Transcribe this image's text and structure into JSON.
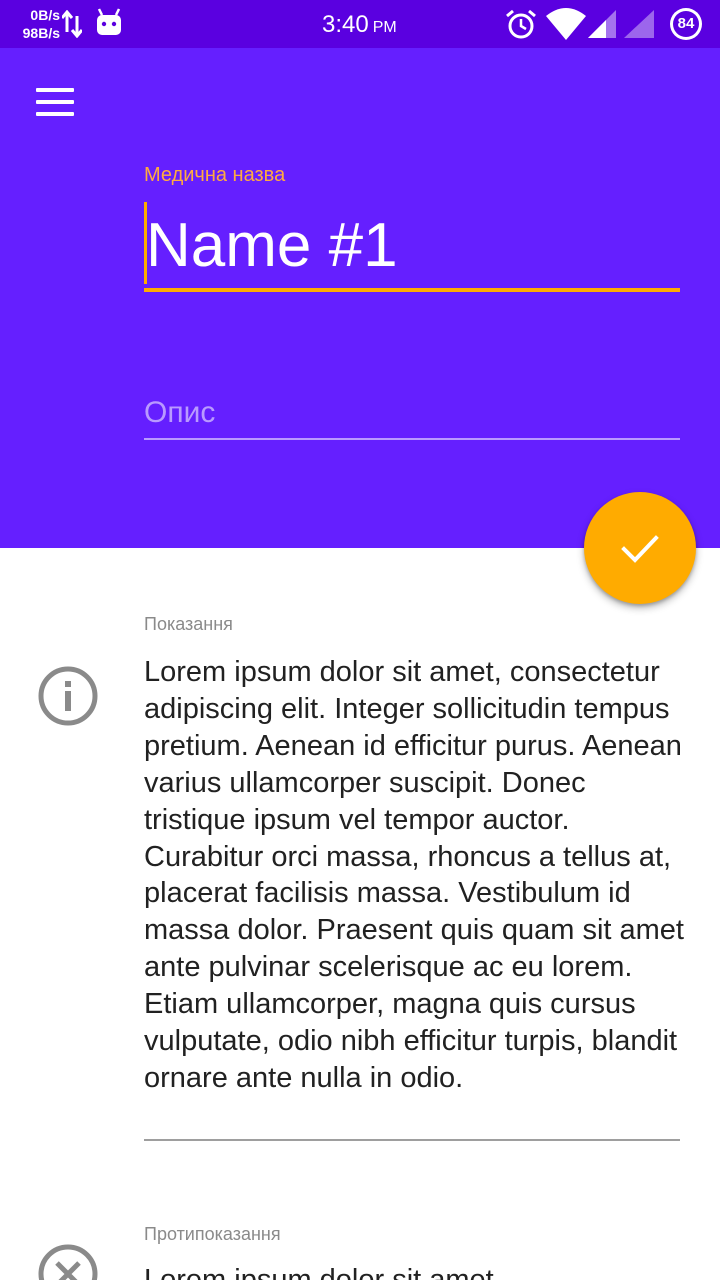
{
  "status_bar": {
    "net_down": "0B/s",
    "net_up": "98B/s",
    "time": "3:40",
    "ampm": "PM",
    "battery": "84",
    "icons": [
      "transfer-arrows-icon",
      "android-icon",
      "alarm-icon",
      "wifi-icon",
      "signal-icon",
      "signal-icon-2",
      "battery-icon"
    ]
  },
  "header": {
    "menu_icon": "hamburger-menu-icon",
    "name_label": "Медична назва",
    "name_value": "Name #1",
    "description_placeholder": "Опис"
  },
  "fab": {
    "icon": "check-icon"
  },
  "sections": [
    {
      "icon": "info-icon",
      "label": "Показання",
      "text": "Lorem ipsum dolor sit amet, consectetur adipiscing elit. Integer sollicitudin tempus pretium. Aenean id efficitur purus. Aenean varius ullamcorper suscipit. Donec tristique ipsum vel tempor auctor. Curabitur orci massa, rhoncus a tellus at, placerat facilisis massa. Vestibulum id massa dolor. Praesent quis quam sit amet ante pulvinar scelerisque ac eu lorem. Etiam ullamcorper, magna quis cursus vulputate, odio nibh efficitur turpis, blandit ornare ante nulla in odio."
    },
    {
      "icon": "cancel-circle-icon",
      "label": "Протипоказання",
      "text": "Lorem ipsum dolor sit amet,"
    }
  ],
  "colors": {
    "primary": "#651fff",
    "primary_dark": "#5a00e0",
    "accent": "#ffab00",
    "label_accent": "#ffab40"
  }
}
